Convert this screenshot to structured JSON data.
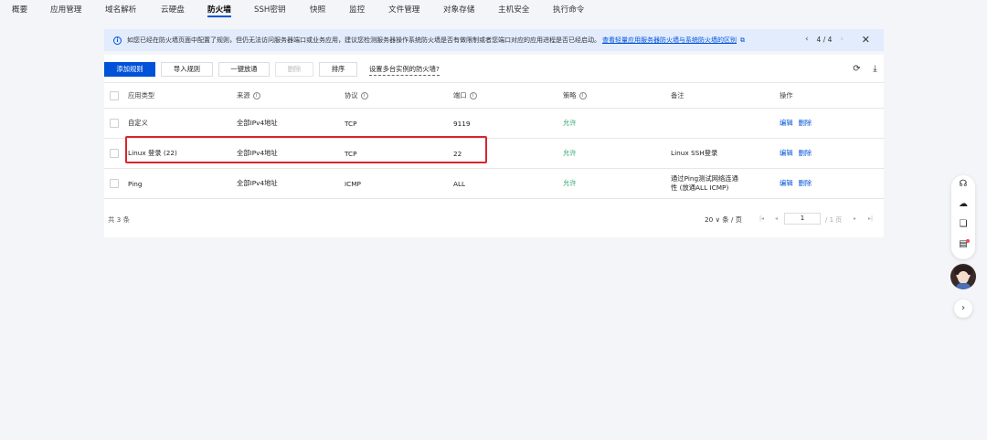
{
  "nav": {
    "tabs": [
      "概要",
      "应用管理",
      "域名解析",
      "云硬盘",
      "防火墙",
      "SSH密钥",
      "快照",
      "监控",
      "文件管理",
      "对象存储",
      "主机安全",
      "执行命令"
    ],
    "active_tab": "防火墙"
  },
  "banner": {
    "message": "如您已经在防火墙页面中配置了规则，但仍无法访问服务器端口或业务应用，建议您检测服务器操作系统防火墙是否有做限制或者您端口对应的应用进程是否已经启动。",
    "link": "查看轻量应用服务器防火墙与系统防火墙的区别",
    "pager": "4 / 4"
  },
  "toolbar": {
    "add_rule": "添加规则",
    "import_rule": "导入规则",
    "one_click_allow": "一键放通",
    "delete": "删除",
    "sort": "排序",
    "multi_instance": "设置多台实例的防火墙?"
  },
  "table": {
    "headers": {
      "app_type": "应用类型",
      "source": "来源",
      "protocol": "协议",
      "port": "端口",
      "policy": "策略",
      "note": "备注",
      "ops": "操作"
    },
    "rows": [
      {
        "app_type": "自定义",
        "source": "全部IPv4地址",
        "protocol": "TCP",
        "port": "9119",
        "policy": "允许",
        "note": "",
        "edit": "编辑",
        "delete": "删除"
      },
      {
        "app_type": "Linux 登录 (22)",
        "source": "全部IPv4地址",
        "protocol": "TCP",
        "port": "22",
        "policy": "允许",
        "note": "Linux SSH登录",
        "edit": "编辑",
        "delete": "删除"
      },
      {
        "app_type": "Ping",
        "source": "全部IPv4地址",
        "protocol": "ICMP",
        "port": "ALL",
        "policy": "允许",
        "note": "通过Ping测试网络连通性 (放通ALL ICMP)",
        "edit": "编辑",
        "delete": "删除"
      }
    ]
  },
  "footer": {
    "total": "共 3 条",
    "page_size": "20 ∨ 条 / 页",
    "page_input": "1",
    "page_total": "/ 1 页"
  },
  "colors": {
    "primary": "#0052d9",
    "allow": "#2ba471",
    "highlight": "#d9252c",
    "banner_bg": "#e2ecfd"
  }
}
